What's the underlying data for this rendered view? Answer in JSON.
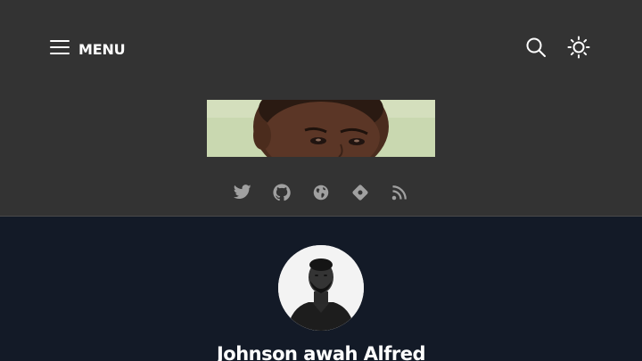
{
  "header": {
    "menu_label": "MENU",
    "menu_icon": "hamburger-icon",
    "search_icon": "search-icon",
    "theme_icon": "sun-icon"
  },
  "banner": {
    "image": "child-face-photo"
  },
  "social_links": [
    {
      "icon": "twitter-icon"
    },
    {
      "icon": "github-icon"
    },
    {
      "icon": "globe-icon"
    },
    {
      "icon": "diamond-icon"
    },
    {
      "icon": "rss-icon"
    }
  ],
  "profile": {
    "avatar": "profile-photo",
    "name": "Johnson awah Alfred"
  },
  "colors": {
    "header_bg": "#333333",
    "profile_bg": "#131a27",
    "icon_color": "#a0a0a0",
    "text_color": "#ffffff"
  }
}
